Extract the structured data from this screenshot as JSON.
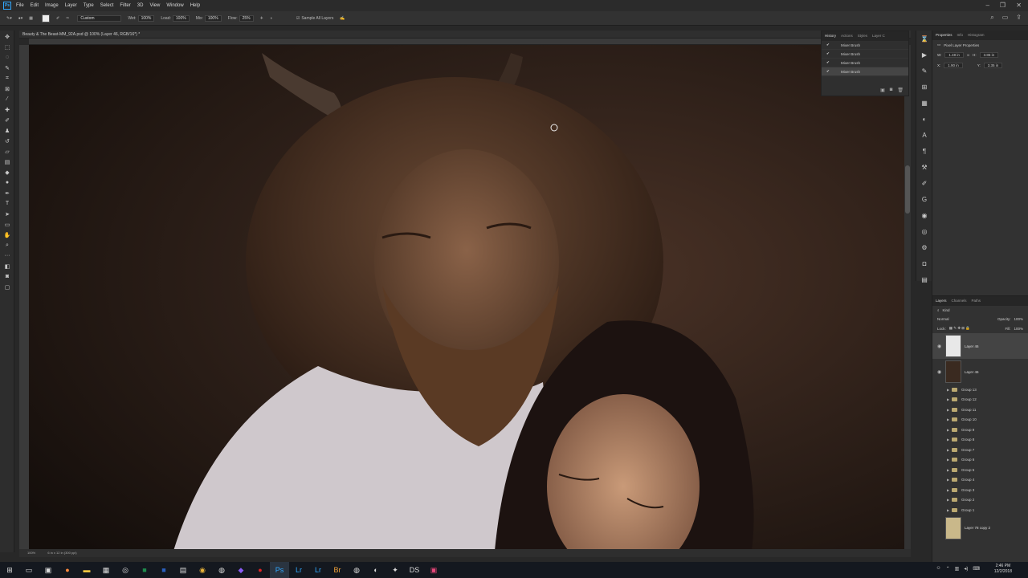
{
  "menu": [
    "File",
    "Edit",
    "Image",
    "Layer",
    "Type",
    "Select",
    "Filter",
    "3D",
    "View",
    "Window",
    "Help"
  ],
  "options": {
    "preset": "Custom",
    "wet_label": "Wet:",
    "wet_value": "100%",
    "load_label": "Load:",
    "load_value": "100%",
    "mix_label": "Mix:",
    "mix_value": "100%",
    "flow_label": "Flow:",
    "flow_value": "25%",
    "sample_all": "Sample All Layers"
  },
  "document": {
    "tab_title": "Beauty & The Beast-MM_92A.psd @ 100% (Layer 46, RGB/16*) *",
    "zoom": "100%",
    "doc_info": "6 in x 12 in (300 ppi)"
  },
  "history": {
    "tabs": [
      "History",
      "Actions",
      "Styles",
      "Layer C"
    ],
    "items": [
      "Mixer Brush",
      "Mixer Brush",
      "Mixer Brush",
      "Mixer Brush"
    ]
  },
  "properties": {
    "tabs": [
      "Properties",
      "Info",
      "Histogram"
    ],
    "title": "Pixel Layer Properties",
    "w_label": "W:",
    "w_value": "1.48 in",
    "h_label": "H:",
    "h_value": "3.86 in",
    "x_label": "X:",
    "x_value": "1.90 in",
    "y_label": "Y:",
    "y_value": "3.35 in"
  },
  "layers": {
    "tabs": [
      "Layers",
      "Channels",
      "Paths"
    ],
    "filter": "Kind",
    "blend": "Normal",
    "opacity_label": "Opacity:",
    "opacity_value": "100%",
    "lock_label": "Lock:",
    "fill_label": "Fill:",
    "fill_value": "100%",
    "top_layers": [
      "Layer 46",
      "Layer 46"
    ],
    "groups": [
      "Group 13",
      "Group 12",
      "Group 11",
      "Group 10",
      "Group 9",
      "Group 8",
      "Group 7",
      "Group 6",
      "Group 5",
      "Group 4",
      "Group 3",
      "Group 2",
      "Group 1"
    ],
    "bottom_layer": "Layer 78 copy 2"
  },
  "taskbar": {
    "time": "2:46 PM",
    "date": "12/2/2018"
  }
}
